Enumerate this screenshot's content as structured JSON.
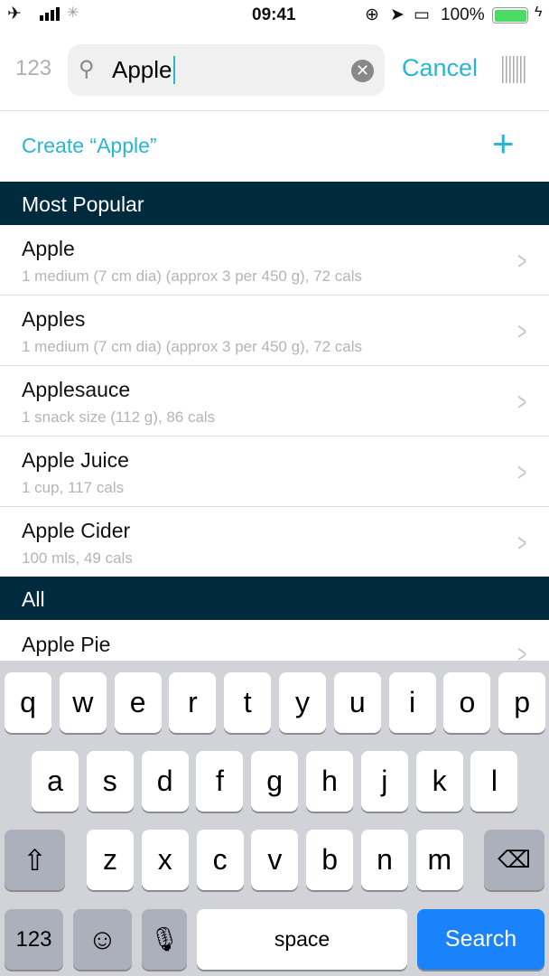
{
  "status": {
    "time": "09:41",
    "battery": "100%",
    "icons": [
      "airplane-icon",
      "signal-icon",
      "loading-icon",
      "rotation-lock-icon",
      "location-icon",
      "airplay-icon",
      "battery-icon",
      "charging-icon"
    ],
    "battery_color": "#4cd964"
  },
  "header": {
    "numeric_toggle": "123",
    "search_value": "Apple",
    "cancel": "Cancel"
  },
  "create": {
    "label": "Create “Apple”"
  },
  "sections": [
    {
      "title": "Most Popular",
      "items": [
        {
          "name": "Apple",
          "detail": "1 medium (7 cm dia) (approx 3 per 450 g), 72 cals"
        },
        {
          "name": "Apples",
          "detail": "1 medium (7 cm dia) (approx 3 per 450 g), 72 cals"
        },
        {
          "name": "Applesauce",
          "detail": "1 snack size (112 g), 86 cals"
        },
        {
          "name": "Apple Juice",
          "detail": "1 cup, 117 cals"
        },
        {
          "name": "Apple Cider",
          "detail": "100 mls, 49 cals"
        }
      ]
    },
    {
      "title": "All",
      "items": [
        {
          "name": "Apple Pie",
          "detail": ""
        }
      ]
    }
  ],
  "keyboard": {
    "row1": [
      "q",
      "w",
      "e",
      "r",
      "t",
      "y",
      "u",
      "i",
      "o",
      "p"
    ],
    "row2": [
      "a",
      "s",
      "d",
      "f",
      "g",
      "h",
      "j",
      "k",
      "l"
    ],
    "row3": [
      "z",
      "x",
      "c",
      "v",
      "b",
      "n",
      "m"
    ],
    "numbers": "123",
    "space": "space",
    "search": "Search"
  },
  "colors": {
    "accent": "#29b5d6",
    "section_bg": "#002b3f",
    "search_key": "#1a82fb"
  }
}
